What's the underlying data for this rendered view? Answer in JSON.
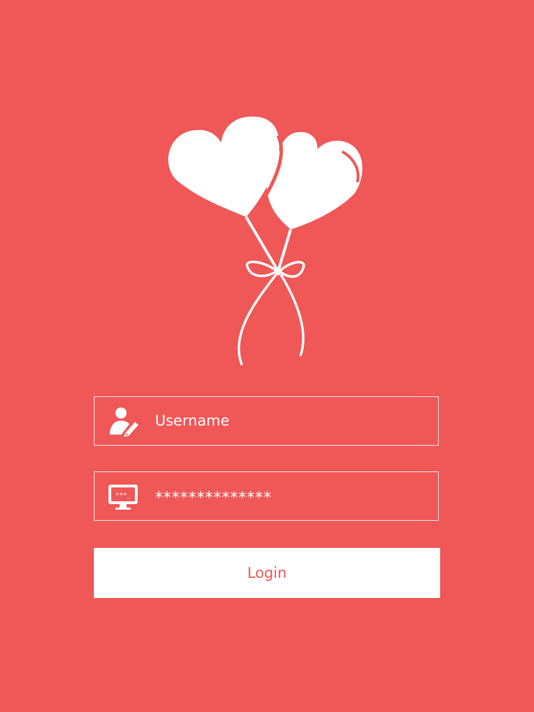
{
  "logo": {
    "icon": "heart-balloons-icon"
  },
  "username_field": {
    "icon": "user-edit-icon",
    "placeholder": "Username"
  },
  "password_field": {
    "icon": "password-monitor-icon",
    "value": "**************"
  },
  "login_button": {
    "label": "Login"
  },
  "colors": {
    "background": "#f05757",
    "foreground": "#ffffff"
  }
}
